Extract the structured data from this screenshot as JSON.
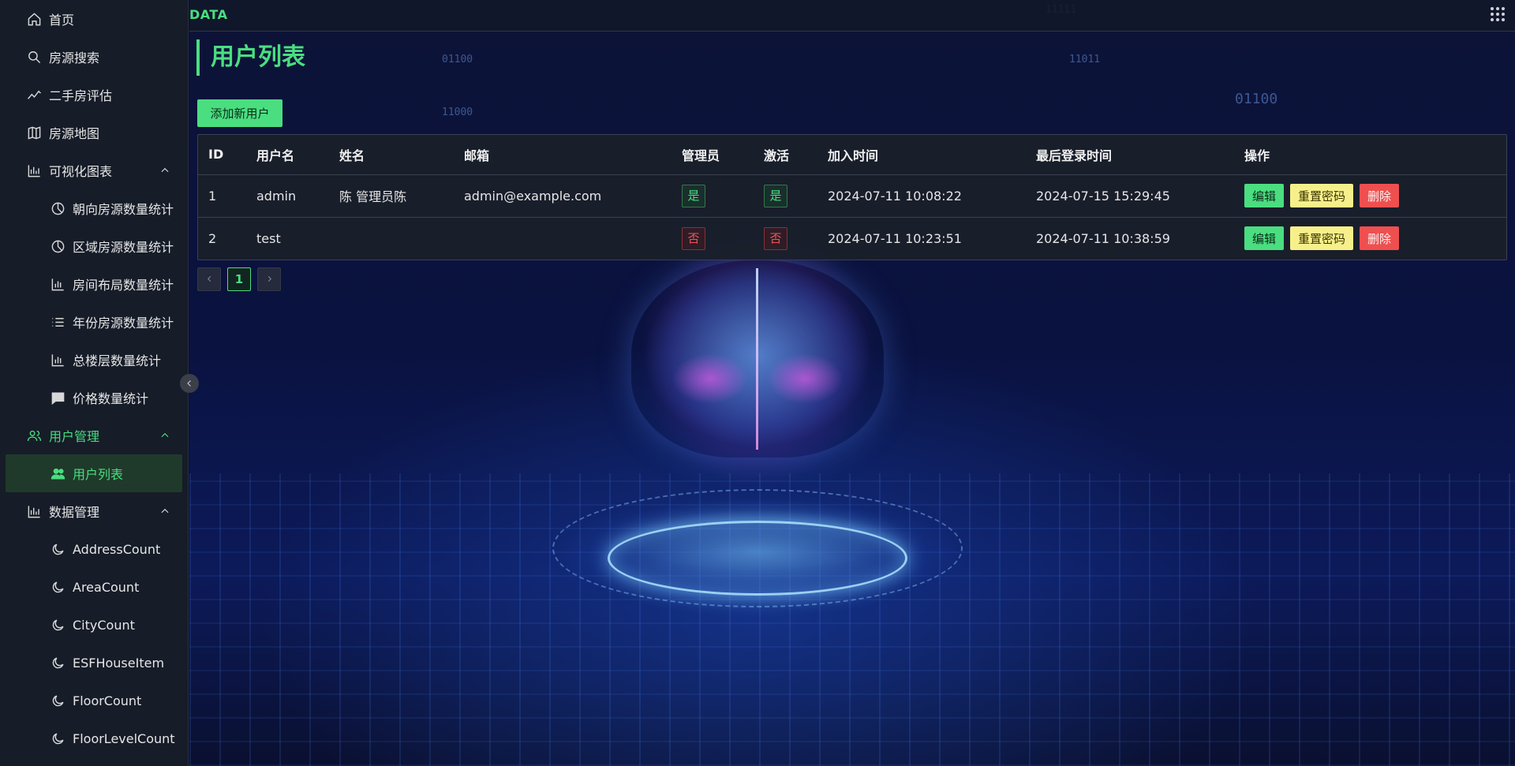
{
  "app": {
    "brand": "DATA"
  },
  "sidebar": {
    "items": [
      {
        "label": "首页",
        "icon": "home-icon"
      },
      {
        "label": "房源搜索",
        "icon": "search-icon"
      },
      {
        "label": "二手房评估",
        "icon": "trend-icon"
      },
      {
        "label": "房源地图",
        "icon": "map-icon"
      },
      {
        "label": "可视化图表",
        "icon": "bar-chart-icon",
        "expanded": true,
        "children": [
          {
            "label": "朝向房源数量统计",
            "icon": "pie-chart-icon"
          },
          {
            "label": "区域房源数量统计",
            "icon": "pie-chart-icon"
          },
          {
            "label": "房间布局数量统计",
            "icon": "bar-chart-icon"
          },
          {
            "label": "年份房源数量统计",
            "icon": "list-icon"
          },
          {
            "label": "总楼层数量统计",
            "icon": "bar-chart-icon"
          },
          {
            "label": "价格数量统计",
            "icon": "message-icon"
          }
        ]
      },
      {
        "label": "用户管理",
        "icon": "users-icon",
        "expanded": true,
        "active": true,
        "children": [
          {
            "label": "用户列表",
            "icon": "users-icon",
            "selected": true
          }
        ]
      },
      {
        "label": "数据管理",
        "icon": "bar-chart-icon",
        "expanded": true,
        "children": [
          {
            "label": "AddressCount",
            "icon": "moon-icon"
          },
          {
            "label": "AreaCount",
            "icon": "moon-icon"
          },
          {
            "label": "CityCount",
            "icon": "moon-icon"
          },
          {
            "label": "ESFHouseItem",
            "icon": "moon-icon"
          },
          {
            "label": "FloorCount",
            "icon": "moon-icon"
          },
          {
            "label": "FloorLevelCount",
            "icon": "moon-icon"
          }
        ]
      }
    ]
  },
  "page": {
    "title": "用户列表",
    "add_button": "添加新用户"
  },
  "table": {
    "columns": [
      "ID",
      "用户名",
      "姓名",
      "邮箱",
      "管理员",
      "激活",
      "加入时间",
      "最后登录时间",
      "操作"
    ],
    "rows": [
      {
        "id": "1",
        "username": "admin",
        "name": "陈 管理员陈",
        "email": "admin@example.com",
        "admin": "是",
        "active": "是",
        "joined": "2024-07-11 10:08:22",
        "last_login": "2024-07-15 15:29:45"
      },
      {
        "id": "2",
        "username": "test",
        "name": "",
        "email": "",
        "admin": "否",
        "active": "否",
        "joined": "2024-07-11 10:23:51",
        "last_login": "2024-07-11 10:38:59"
      }
    ],
    "actions": {
      "edit": "编辑",
      "reset": "重置密码",
      "delete": "删除"
    }
  },
  "pagination": {
    "current": "1"
  },
  "colors": {
    "accent": "#4ade80",
    "warning": "#f7f08a",
    "danger": "#ef4f4f",
    "sidebar_bg": "#161c28"
  },
  "decor": [
    "01100",
    "11000",
    "11011",
    "01100",
    "11111"
  ]
}
